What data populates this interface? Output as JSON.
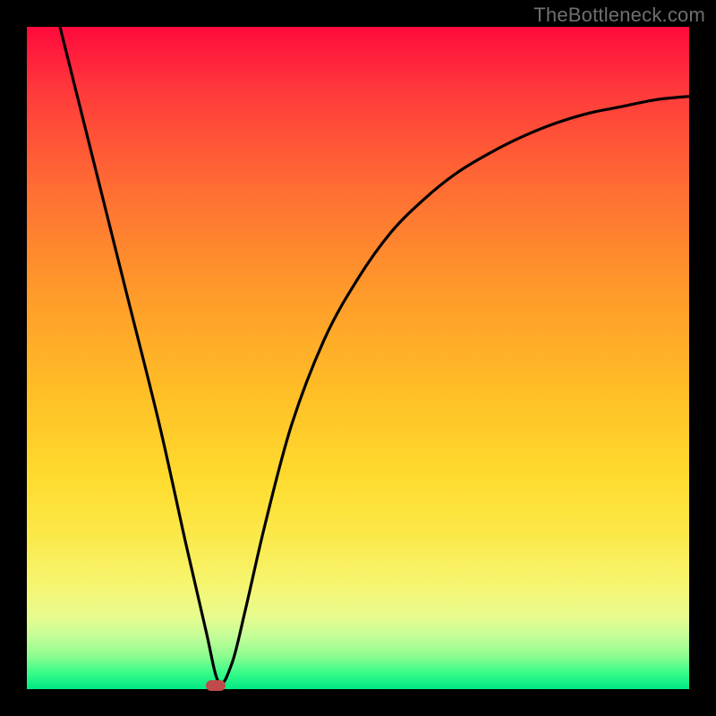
{
  "watermark": "TheBottleneck.com",
  "chart_data": {
    "type": "line",
    "title": "",
    "xlabel": "",
    "ylabel": "",
    "xlim": [
      0,
      100
    ],
    "ylim": [
      0,
      100
    ],
    "grid": false,
    "legend": false,
    "note": "Axes are unlabeled in the source image; coordinates are estimated as percentages of the plot area (0 = left/bottom, 100 = right/top).",
    "series": [
      {
        "name": "bottleneck-curve",
        "x": [
          5,
          10,
          15,
          20,
          24,
          27,
          29,
          31,
          33,
          36,
          40,
          45,
          50,
          55,
          60,
          65,
          70,
          75,
          80,
          85,
          90,
          95,
          100
        ],
        "y": [
          100,
          80,
          60,
          40,
          22,
          9,
          1,
          4,
          12,
          25,
          40,
          53,
          62,
          69,
          74,
          78,
          81,
          83.5,
          85.5,
          87,
          88,
          89,
          89.5
        ]
      }
    ],
    "marker": {
      "x": 28.5,
      "y": 0.5
    },
    "background_gradient": {
      "direction": "top-to-bottom",
      "stops": [
        {
          "pos": 0,
          "color": "#ff0a3c"
        },
        {
          "pos": 0.25,
          "color": "#ff6f33"
        },
        {
          "pos": 0.55,
          "color": "#ffbe26"
        },
        {
          "pos": 0.8,
          "color": "#f6f56f"
        },
        {
          "pos": 0.95,
          "color": "#8dfd90"
        },
        {
          "pos": 1.0,
          "color": "#00e884"
        }
      ]
    }
  }
}
